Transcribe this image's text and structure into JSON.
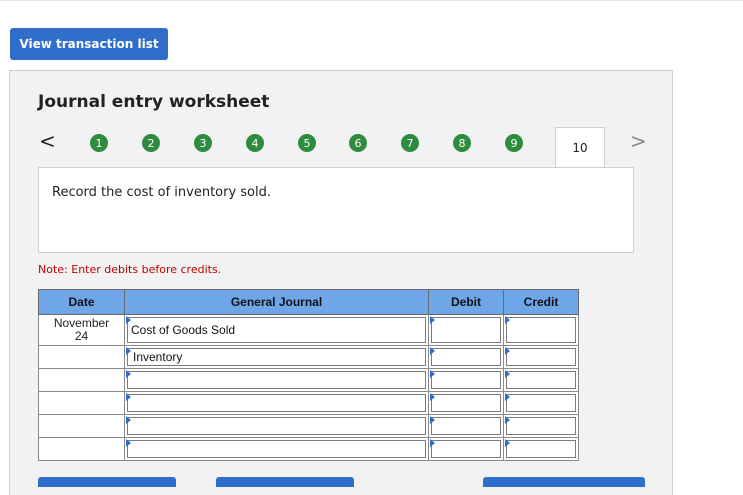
{
  "header": {
    "view_transaction_list_label": "View transaction list"
  },
  "worksheet": {
    "title": "Journal entry worksheet",
    "nav_prev_glyph": "<",
    "nav_next_glyph": ">",
    "steps": [
      "1",
      "2",
      "3",
      "4",
      "5",
      "6",
      "7",
      "8",
      "9"
    ],
    "active_step": "10",
    "instruction": "Record the cost of inventory sold.",
    "note": "Note: Enter debits before credits."
  },
  "journal": {
    "headers": {
      "date": "Date",
      "general_journal": "General Journal",
      "debit": "Debit",
      "credit": "Credit"
    },
    "rows": [
      {
        "date_line1": "November",
        "date_line2": "24",
        "account": "Cost of Goods Sold",
        "debit": "",
        "credit": ""
      },
      {
        "date_line1": "",
        "date_line2": "",
        "account": "Inventory",
        "debit": "",
        "credit": ""
      },
      {
        "date_line1": "",
        "date_line2": "",
        "account": "",
        "debit": "",
        "credit": ""
      },
      {
        "date_line1": "",
        "date_line2": "",
        "account": "",
        "debit": "",
        "credit": ""
      },
      {
        "date_line1": "",
        "date_line2": "",
        "account": "",
        "debit": "",
        "credit": ""
      },
      {
        "date_line1": "",
        "date_line2": "",
        "account": "",
        "debit": "",
        "credit": ""
      }
    ]
  },
  "colors": {
    "button_blue": "#2f6fcb",
    "step_green": "#2e8b3f",
    "header_blue": "#6ea6e8",
    "note_red": "#c00000"
  },
  "icons": {
    "prev": "chevron-left-icon",
    "next": "chevron-right-icon",
    "field_marker": "triangle-marker-icon"
  }
}
